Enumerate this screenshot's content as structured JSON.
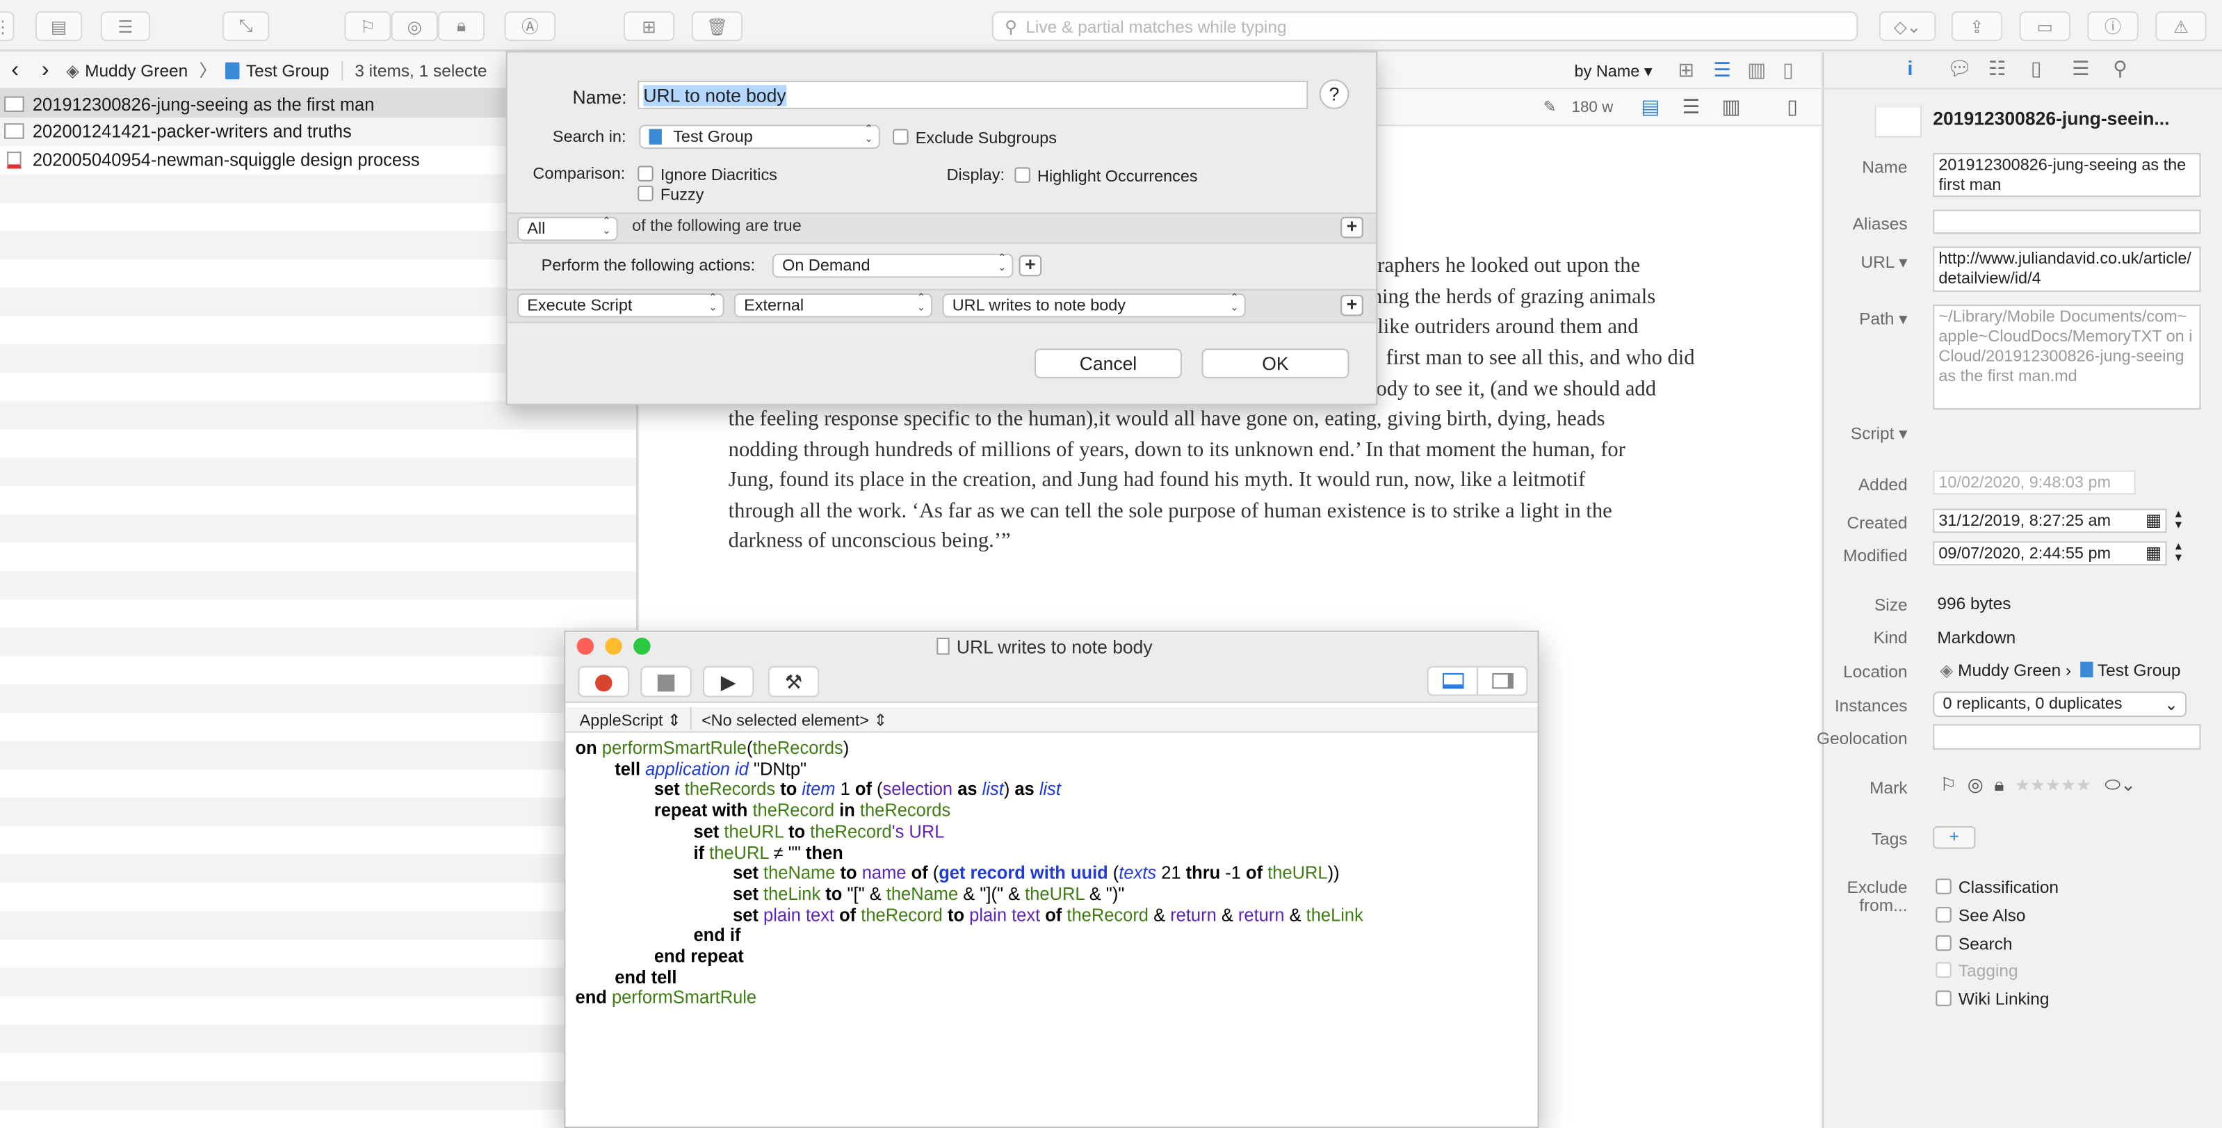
{
  "toolbar": {
    "search_placeholder": "Live & partial matches while typing"
  },
  "pathbar": {
    "database": "Muddy Green",
    "group": "Test Group",
    "count": "3 items, 1 selecte"
  },
  "list": {
    "items": [
      "201912300826-jung-seeing as the first man",
      "202001241421-packer-writers and truths",
      "202005040954-newman-squiggle design process"
    ]
  },
  "sort": {
    "label": "by Name"
  },
  "docbar": {
    "width": "180 w"
  },
  "document": {
    "lines": [
      "ographers he looked out upon the",
      "tching the herds of grazing animals",
      "like outriders around them and",
      "first man to see all this, and who did",
      "ebody to see it, (and we should add",
      "the feeling response specific to the human),it would all have gone on, eating, giving birth, dying, heads",
      "nodding through hundreds of millions of years, down to its unknown end.’ In that moment the human, for",
      "Jung, found its place in the creation, and Jung had found his myth. It would run, now, like a leitmotif",
      "through all the work. ‘As far as we can tell the sole purpose of human existence is to strike a light in the",
      "darkness of unconscious being.’”"
    ]
  },
  "smart_rule": {
    "name_label": "Name:",
    "name_value": "URL to note body",
    "help": "?",
    "search_in_label": "Search in:",
    "search_in_value": "Test Group",
    "exclude_subgroups": "Exclude Subgroups",
    "comparison_label": "Comparison:",
    "ignore_diacritics": "Ignore Diacritics",
    "fuzzy": "Fuzzy",
    "display_label": "Display:",
    "highlight": "Highlight Occurrences",
    "match_value": "All",
    "match_suffix": "of the following are true",
    "actions_label": "Perform the following actions:",
    "actions_value": "On Demand",
    "action_type": "Execute Script",
    "action_source": "External",
    "action_script": "URL writes to note body",
    "cancel": "Cancel",
    "ok": "OK"
  },
  "script_editor": {
    "title": "URL writes to note body",
    "language": "AppleScript",
    "element": "<No selected element>"
  },
  "inspector": {
    "title": "201912300826-jung-seein...",
    "name_label": "Name",
    "name_value": "201912300826-jung-seeing as the first man",
    "aliases_label": "Aliases",
    "url_label": "URL",
    "url_value": "http://www.juliandavid.co.uk/article/detailview/id/4",
    "path_label": "Path",
    "path_value": "~/Library/Mobile Documents/com~apple~CloudDocs/MemoryTXT on iCloud/201912300826-jung-seeing as the first man.md",
    "script_label": "Script",
    "added_label": "Added",
    "added_value": "10/02/2020,  9:48:03 pm",
    "created_label": "Created",
    "created_value": "31/12/2019,  8:27:25 am",
    "modified_label": "Modified",
    "modified_value": "09/07/2020,  2:44:55 pm",
    "size_label": "Size",
    "size_value": "996 bytes",
    "kind_label": "Kind",
    "kind_value": "Markdown",
    "location_label": "Location",
    "location_db": "Muddy Green ›",
    "location_group": "Test Group",
    "instances_label": "Instances",
    "instances_value": "0 replicants, 0 duplicates",
    "geolocation_label": "Geolocation",
    "mark_label": "Mark",
    "tags_label": "Tags",
    "exclude_label_1": "Exclude",
    "exclude_label_2": "from...",
    "exclude_items": [
      "Classification",
      "See Also",
      "Search",
      "Tagging",
      "Wiki Linking"
    ]
  }
}
